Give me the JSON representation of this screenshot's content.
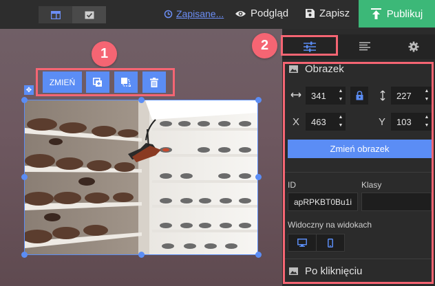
{
  "topbar": {
    "saved_label": "Zapisane...",
    "preview_label": "Podgląd",
    "save_label": "Zapisz",
    "publish_label": "Publikuj"
  },
  "annotations": {
    "badge_1": "1",
    "badge_2": "2",
    "color": "#f56573"
  },
  "image_toolbar": {
    "change_label": "ZMIEŃ",
    "icons": [
      "duplicate-icon",
      "layer-order-icon",
      "trash-icon"
    ]
  },
  "panel": {
    "section_image": "Obrazek",
    "width": "341",
    "height": "227",
    "x_label": "X",
    "x": "463",
    "y_label": "Y",
    "y": "103",
    "change_image_label": "Zmień obrazek",
    "id_label": "ID",
    "id_value": "apRPKBT0Bu1i",
    "classes_label": "Klasy",
    "classes_value": "",
    "visible_label": "Widoczny na widokach",
    "on_click_label": "Po kliknięciu"
  },
  "colors": {
    "accent": "#5b8df5",
    "publish": "#3cb878",
    "panel_bg": "#2b2b2b"
  }
}
